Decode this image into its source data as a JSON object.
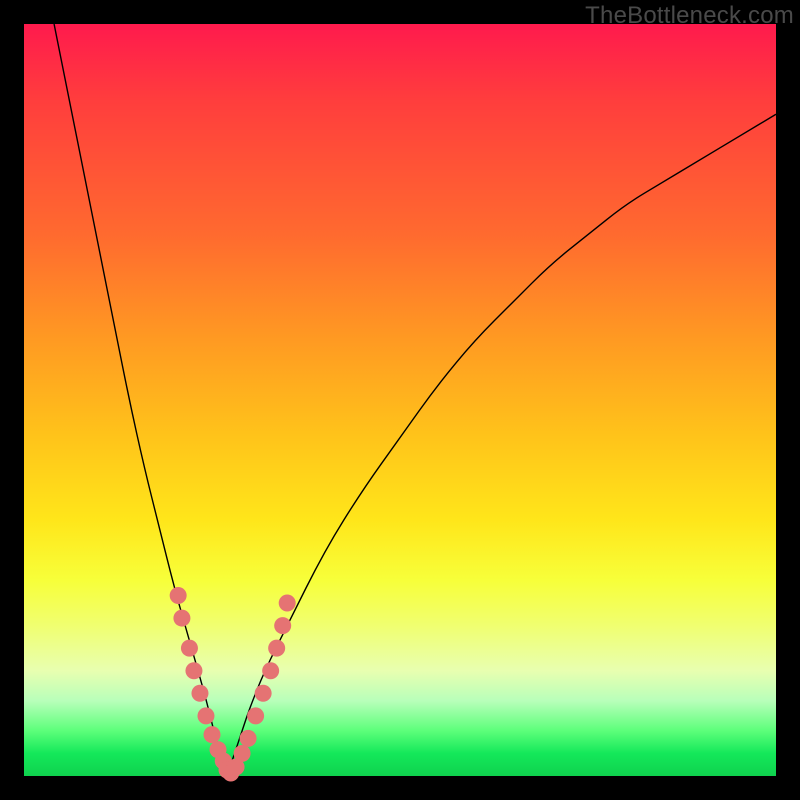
{
  "watermark": "TheBottleneck.com",
  "colors": {
    "frame": "#000000",
    "gradient_top": "#ff1a4d",
    "gradient_mid1": "#ff9a22",
    "gradient_mid2": "#ffe61a",
    "gradient_bottom": "#0fd24e",
    "curve": "#000000",
    "marker": "#e57373"
  },
  "chart_data": {
    "type": "line",
    "title": "",
    "xlabel": "",
    "ylabel": "",
    "xlim": [
      0,
      100
    ],
    "ylim": [
      0,
      100
    ],
    "grid": false,
    "legend": false,
    "description": "V-shaped bottleneck curve. Two black lines descend steeply from upper-left and upper-right, meeting near the bottom around x≈27; the green band at the bottom indicates optimal (near-zero bottleneck) and red at top indicates severe bottleneck.",
    "series": [
      {
        "name": "left-branch",
        "x": [
          4,
          6,
          8,
          10,
          12,
          14,
          16,
          18,
          20,
          22,
          24,
          25,
          26,
          27
        ],
        "y": [
          100,
          90,
          80,
          70,
          60,
          50,
          41,
          33,
          25,
          18,
          11,
          7,
          3,
          0
        ]
      },
      {
        "name": "right-branch",
        "x": [
          27,
          28,
          29,
          30,
          32,
          35,
          40,
          45,
          50,
          55,
          60,
          65,
          70,
          75,
          80,
          85,
          90,
          95,
          100
        ],
        "y": [
          0,
          3,
          6,
          9,
          14,
          20,
          30,
          38,
          45,
          52,
          58,
          63,
          68,
          72,
          76,
          79,
          82,
          85,
          88
        ]
      }
    ],
    "markers": {
      "name": "sample-points",
      "note": "Salmon dots clustered along both branches near the vertex in the yellow-green band",
      "points": [
        {
          "x": 20.5,
          "y": 24
        },
        {
          "x": 21.0,
          "y": 21
        },
        {
          "x": 22.0,
          "y": 17
        },
        {
          "x": 22.6,
          "y": 14
        },
        {
          "x": 23.4,
          "y": 11
        },
        {
          "x": 24.2,
          "y": 8
        },
        {
          "x": 25.0,
          "y": 5.5
        },
        {
          "x": 25.8,
          "y": 3.5
        },
        {
          "x": 26.5,
          "y": 2
        },
        {
          "x": 27.0,
          "y": 0.8
        },
        {
          "x": 27.5,
          "y": 0.4
        },
        {
          "x": 28.2,
          "y": 1.2
        },
        {
          "x": 29.0,
          "y": 3
        },
        {
          "x": 29.8,
          "y": 5
        },
        {
          "x": 30.8,
          "y": 8
        },
        {
          "x": 31.8,
          "y": 11
        },
        {
          "x": 32.8,
          "y": 14
        },
        {
          "x": 33.6,
          "y": 17
        },
        {
          "x": 34.4,
          "y": 20
        },
        {
          "x": 35.0,
          "y": 23
        }
      ]
    }
  }
}
